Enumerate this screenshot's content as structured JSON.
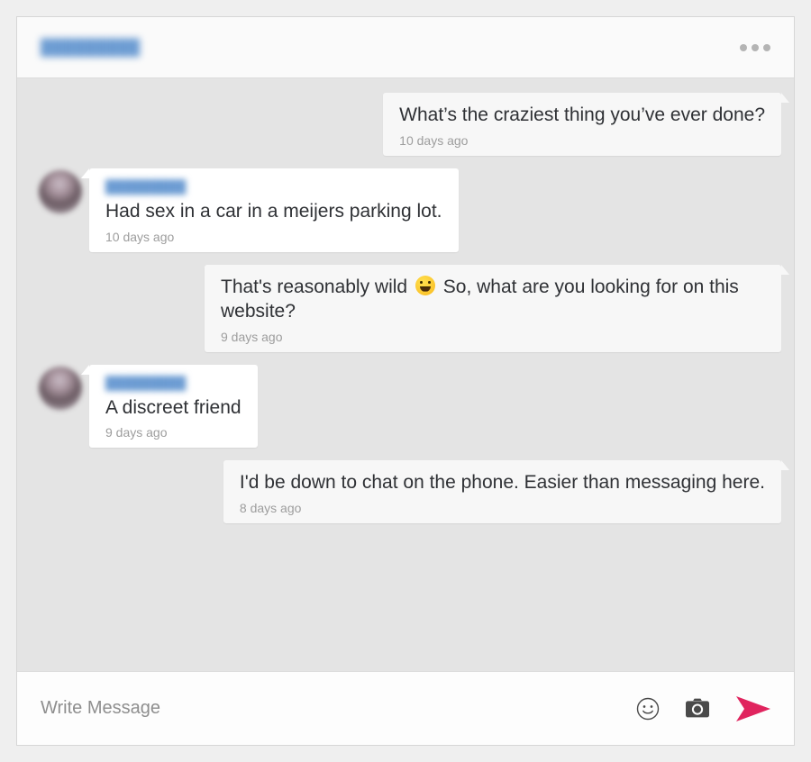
{
  "header": {
    "username": "█████████",
    "username_redacted": true,
    "menu_icon": "kebab-menu-icon",
    "accent_username_color": "#6b9bd2"
  },
  "conversation": {
    "messages": [
      {
        "direction": "outgoing",
        "text": "What’s the craziest thing you’ve ever done?",
        "time": "10 days ago",
        "username": "",
        "has_avatar": false,
        "has_emoji": false
      },
      {
        "direction": "incoming",
        "text": "Had sex in a car in a meijers parking lot.",
        "time": "10 days ago",
        "username": "█████████",
        "has_avatar": true,
        "has_emoji": false
      },
      {
        "direction": "outgoing",
        "text_before_emoji": "That's reasonably wild ",
        "emoji": "grinning-face-emoji",
        "text_after_emoji": " So, what are you looking for on this website?",
        "text": "That's reasonably wild 😄 So, what are you looking for on this website?",
        "time": "9 days ago",
        "username": "",
        "has_avatar": false,
        "has_emoji": true
      },
      {
        "direction": "incoming",
        "text": "A discreet friend",
        "time": "9 days ago",
        "username": "█████████",
        "has_avatar": true,
        "has_emoji": false
      },
      {
        "direction": "outgoing",
        "text": "I'd be down to chat on the phone. Easier than messaging here.",
        "time": "8 days ago",
        "username": "",
        "has_avatar": false,
        "has_emoji": false
      }
    ]
  },
  "composer": {
    "placeholder": "Write Message",
    "value": "",
    "emoji_icon": "smiley-face-icon",
    "camera_icon": "camera-icon",
    "send_icon": "send-arrow-icon",
    "send_color": "#e0245e"
  },
  "colors": {
    "page_background": "#efefef",
    "chat_background": "#e4e4e4",
    "incoming_bubble": "#ffffff",
    "outgoing_bubble": "#f7f7f7",
    "header_background": "#fafafa",
    "composer_background": "#fdfdfd",
    "text": "#2f3135",
    "timestamp": "#9d9d9d"
  }
}
